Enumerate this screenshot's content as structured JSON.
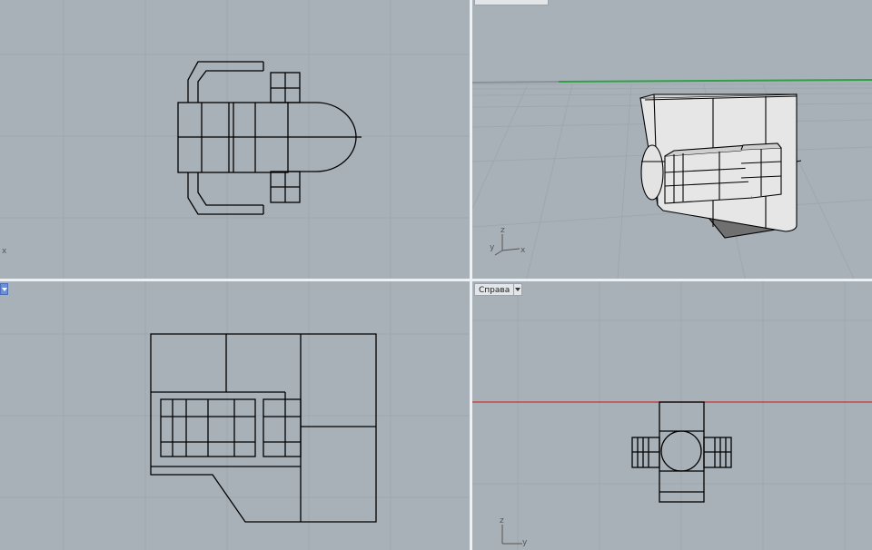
{
  "viewports": {
    "top": {
      "axis_x": "x"
    },
    "perspective": {
      "tab_label": "",
      "axis_x": "x",
      "axis_y": "y",
      "axis_z": "z"
    },
    "front": {
      "tab_label": ""
    },
    "right": {
      "tab_label": "Справа",
      "axis_y": "y",
      "axis_z": "z"
    }
  },
  "colors": {
    "viewport_bg": "#a9b1b8",
    "grid": "#9fa7ae",
    "x_axis": "#c83232",
    "y_axis": "#2fa045",
    "model_line": "#000000",
    "shaded_surface": "#e6e6e6",
    "active_tab": "#6f8fd8"
  },
  "icons": [
    "dropdown-arrow-icon",
    "axis-gizmo-icon"
  ]
}
